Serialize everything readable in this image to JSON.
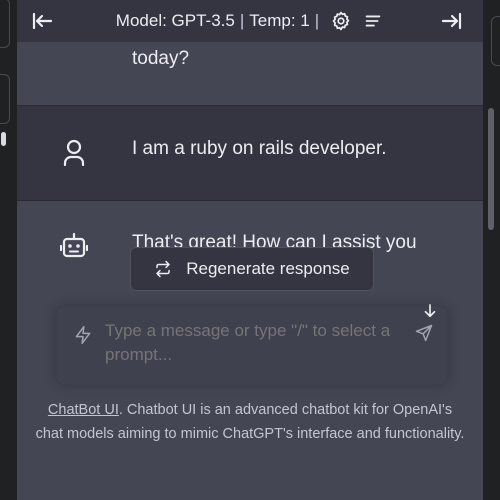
{
  "header": {
    "model_label": "Model: GPT-3.5",
    "temp_label": "Temp: 1",
    "separator": "|",
    "collapse_left_icon": "arrow-left-bar-icon",
    "settings_icon": "gear-icon",
    "clear_icon": "list-icon",
    "collapse_right_icon": "arrow-right-bar-icon"
  },
  "messages": [
    {
      "role": "assistant",
      "text": "today?"
    },
    {
      "role": "user",
      "text": "I am a ruby on rails developer.",
      "avatar_icon": "user-icon"
    },
    {
      "role": "assistant",
      "text_visible": "That's great! How can I assist you",
      "avatar_icon": "robot-icon"
    }
  ],
  "regenerate": {
    "label": "Regenerate response",
    "icon": "refresh-icon"
  },
  "input": {
    "placeholder": "Type a message or type \"/\" to select a prompt...",
    "icon": "bolt-icon",
    "send_icon": "send-icon"
  },
  "scroll_down_icon": "arrow-down-icon",
  "footer": {
    "link_text": "ChatBot UI",
    "text": ". Chatbot UI is an advanced chatbot kit for OpenAI's chat models aiming to mimic ChatGPT's interface and functionality."
  },
  "colors": {
    "main_bg": "#343541",
    "assistant_bg": "#444654",
    "sidebar_bg": "#202123",
    "input_bg": "#40414f"
  }
}
